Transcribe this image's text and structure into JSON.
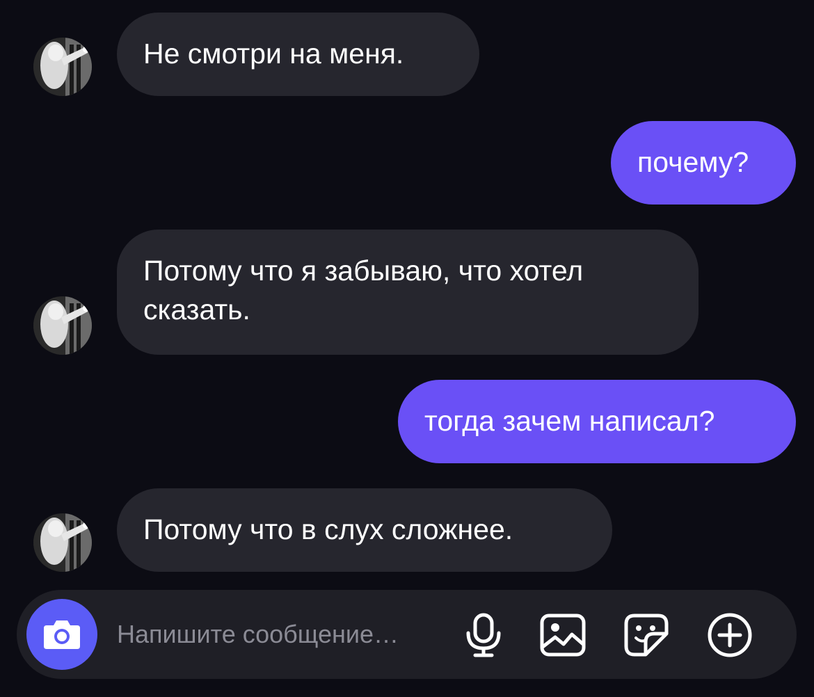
{
  "messages": [
    {
      "direction": "incoming",
      "text": "Не смотри на меня."
    },
    {
      "direction": "outgoing",
      "text": "почему?"
    },
    {
      "direction": "incoming",
      "text": "Потому что я забываю, что хотел\nсказать."
    },
    {
      "direction": "outgoing",
      "text": "тогда зачем написал?"
    },
    {
      "direction": "incoming",
      "text": "Потому что в слух сложнее."
    }
  ],
  "composer": {
    "placeholder": "Напишите сообщение…",
    "buttons": [
      "camera-icon",
      "microphone-icon",
      "image-icon",
      "sticker-icon",
      "plus-circle-icon"
    ]
  },
  "colors": {
    "background": "#0c0c14",
    "incoming_bubble": "#26262e",
    "outgoing_bubble": "#6a50f6",
    "camera_button": "#5b5cf6",
    "placeholder": "#8b8b95"
  }
}
